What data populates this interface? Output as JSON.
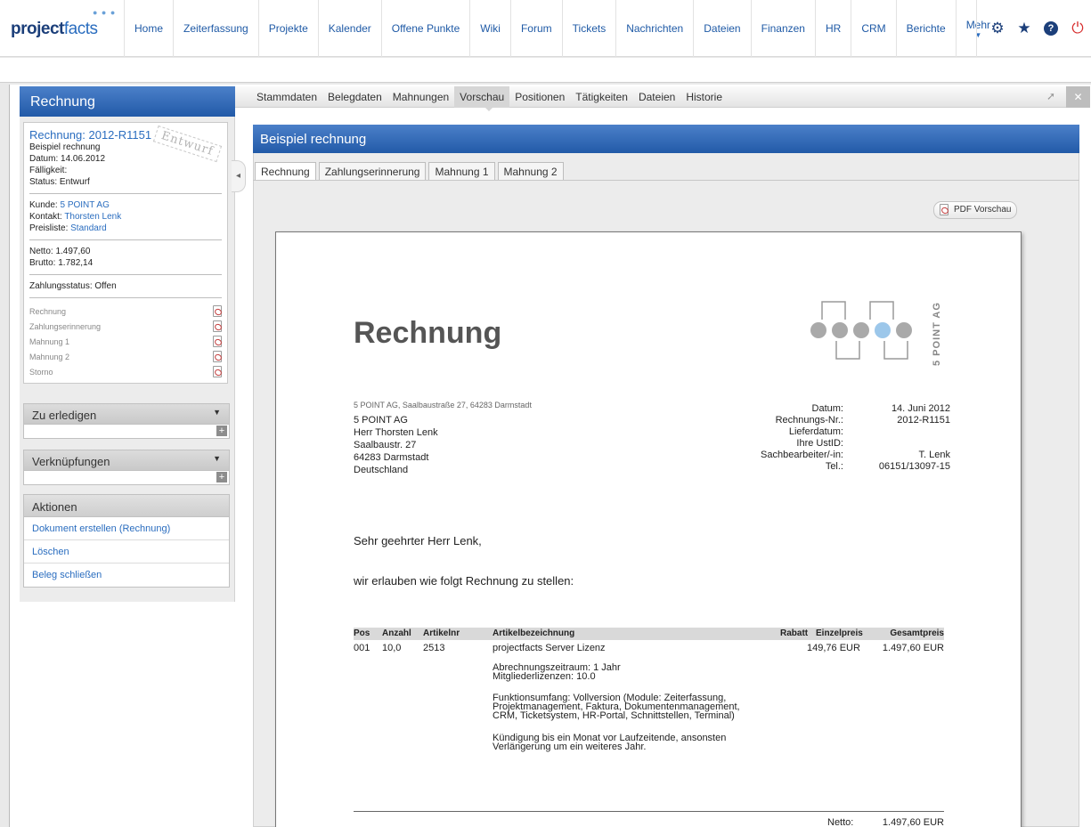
{
  "app": {
    "logo_main": "project",
    "logo_accent": "facts"
  },
  "nav": {
    "items": [
      "Home",
      "Zeiterfassung",
      "Projekte",
      "Kalender",
      "Offene Punkte",
      "Wiki",
      "Forum",
      "Tickets",
      "Nachrichten",
      "Dateien",
      "Finanzen",
      "HR",
      "CRM",
      "Berichte",
      "Mehr"
    ],
    "icons": [
      "gear-icon",
      "star-icon",
      "help-icon",
      "power-icon"
    ]
  },
  "module": {
    "title": "Rechnung",
    "tabs": [
      "Stammdaten",
      "Belegdaten",
      "Mahnungen",
      "Vorschau",
      "Positionen",
      "Tätigkeiten",
      "Dateien",
      "Historie"
    ],
    "active_tab": "Vorschau"
  },
  "sidebar": {
    "doc_title": "Rechnung: 2012-R1151",
    "stamp": "Entwurf",
    "lines": [
      "Beispiel rechnung",
      "Datum: 14.06.2012",
      "Fälligkeit:",
      "Status: Entwurf"
    ],
    "kunde_label": "Kunde:",
    "kunde_value": "5 POINT AG",
    "kontakt_label": "Kontakt:",
    "kontakt_value": "Thorsten Lenk",
    "preisliste_label": "Preisliste:",
    "preisliste_value": "Standard",
    "netto": "Netto: 1.497,60",
    "brutto": "Brutto: 1.782,14",
    "zahlungsstatus": "Zahlungsstatus: Offen",
    "documents": [
      "Rechnung",
      "Zahlungserinnerung",
      "Mahnung 1",
      "Mahnung 2",
      "Storno"
    ],
    "zu_erledigen": "Zu erledigen",
    "verknuepfungen": "Verknüpfungen",
    "aktionen_title": "Aktionen",
    "aktionen": [
      "Dokument erstellen (Rechnung)",
      "Löschen",
      "Beleg schließen"
    ]
  },
  "main": {
    "title": "Beispiel rechnung",
    "subtabs": [
      "Rechnung",
      "Zahlungserinnerung",
      "Mahnung 1",
      "Mahnung 2"
    ],
    "active_subtab": "Rechnung",
    "pdf_button": "PDF Vorschau"
  },
  "document": {
    "heading": "Rechnung",
    "company_logo_text": "5 POINT AG",
    "sender_line": "5 POINT AG, Saalbaustraße 27, 64283 Darmstadt",
    "recipient": [
      "5 POINT AG",
      "Herr Thorsten Lenk",
      "Saalbaustr. 27",
      "64283 Darmstadt",
      "Deutschland"
    ],
    "meta": [
      {
        "k": "Datum:",
        "v": "14. Juni 2012"
      },
      {
        "k": "Rechnungs-Nr.:",
        "v": "2012-R1151"
      },
      {
        "k": "Lieferdatum:",
        "v": ""
      },
      {
        "k": "Ihre UstID:",
        "v": ""
      },
      {
        "k": "Sachbearbeiter/-in:",
        "v": "T. Lenk"
      },
      {
        "k": "Tel.:",
        "v": "06151/13097-15"
      }
    ],
    "greeting": "Sehr geehrter Herr Lenk,",
    "intro": "wir erlauben wie folgt Rechnung zu stellen:",
    "table_headers": [
      "Pos",
      "Anzahl",
      "Artikelnr",
      "Artikelbezeichnung",
      "Rabatt",
      "Einzelpreis",
      "Gesamtpreis"
    ],
    "row": {
      "pos": "001",
      "anzahl": "10,0",
      "artikelnr": "2513",
      "bezeichnung": "projectfacts Server Lizenz",
      "rabatt": "",
      "einzelpreis": "149,76 EUR",
      "gesamtpreis": "1.497,60 EUR"
    },
    "desc_blocks": [
      [
        "Abrechnungszeitraum: 1 Jahr",
        "Mitgliederlizenzen: 10.0"
      ],
      [
        "Funktionsumfang: Vollversion (Module: Zeiterfassung,",
        "Projektmanagement, Faktura,  Dokumentenmanagement,",
        "CRM, Ticketsystem, HR-Portal, Schnittstellen, Terminal)"
      ],
      [
        "Kündigung bis ein Monat vor Laufzeitende, ansonsten",
        "Verlängerung um ein weiteres Jahr."
      ]
    ],
    "netto_label": "Netto:",
    "netto_value": "1.497,60 EUR"
  }
}
